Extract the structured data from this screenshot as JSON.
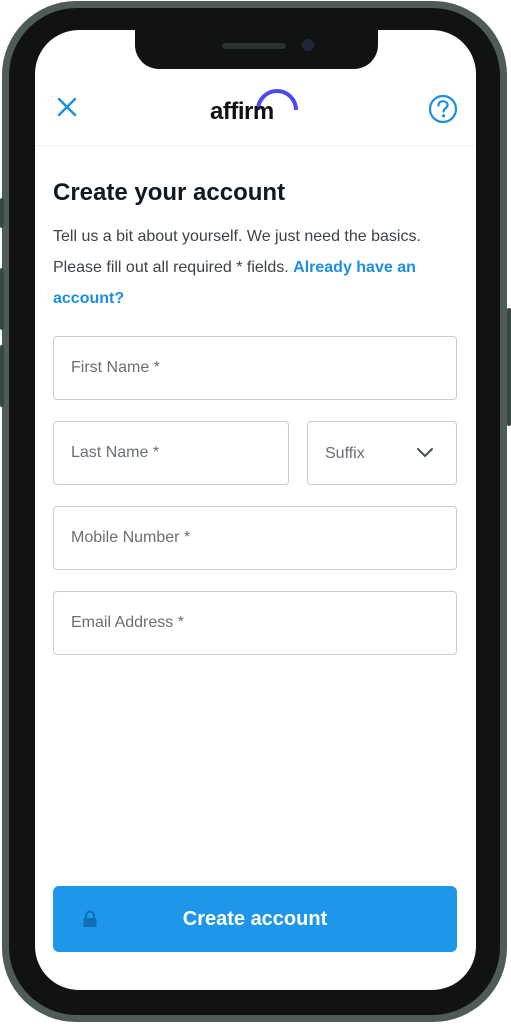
{
  "header": {
    "close_icon": "close-icon",
    "logo_text": "affirm",
    "help_icon": "help-icon",
    "accent": "#1a8fe3"
  },
  "form": {
    "title": "Create your account",
    "intro_text": "Tell us a bit about yourself. We just need the basics. Please fill out all required * fields.",
    "signin_link": "Already have an account?",
    "first_name": {
      "placeholder": "First Name *",
      "value": ""
    },
    "last_name": {
      "placeholder": "Last Name *",
      "value": ""
    },
    "suffix": {
      "selected": "Suffix"
    },
    "mobile": {
      "placeholder": "Mobile Number *",
      "value": ""
    },
    "email": {
      "placeholder": "Email Address *",
      "value": ""
    }
  },
  "submit": {
    "label": "Create account",
    "icon": "lock-icon",
    "color": "#1e97ea"
  }
}
